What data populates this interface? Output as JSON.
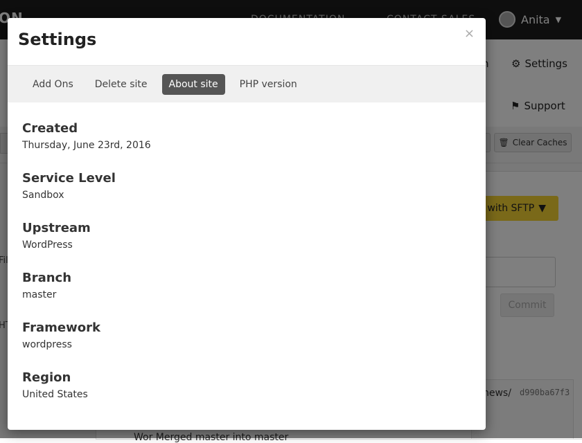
{
  "background": {
    "logo_text": "ON",
    "nav": [
      "DOCUMENTATION",
      "CONTACT SALES"
    ],
    "user_name": "Anita",
    "header_items": [
      {
        "label": "n"
      },
      {
        "label": "Settings",
        "icon": "gear-icon"
      }
    ],
    "subnav_items": [
      {
        "label": "Support",
        "icon": "flag-icon"
      }
    ],
    "clear_caches_label": "Clear Caches",
    "sftp_label": "t with SFTP",
    "commit_label": "Commit",
    "log_path": "news/",
    "log_hash": "d990ba67f3",
    "log_message": "Wor Merged master into master",
    "side_fragments": [
      "Fil",
      "HT"
    ]
  },
  "modal": {
    "title": "Settings",
    "close_symbol": "×",
    "tabs": [
      {
        "label": "Add Ons",
        "active": false
      },
      {
        "label": "Delete site",
        "active": false
      },
      {
        "label": "About site",
        "active": true
      },
      {
        "label": "PHP version",
        "active": false
      }
    ],
    "fields": [
      {
        "label": "Created",
        "value": "Thursday, June 23rd, 2016"
      },
      {
        "label": "Service Level",
        "value": "Sandbox"
      },
      {
        "label": "Upstream",
        "value": "WordPress"
      },
      {
        "label": "Branch",
        "value": "master"
      },
      {
        "label": "Framework",
        "value": "wordpress"
      },
      {
        "label": "Region",
        "value": "United States"
      }
    ]
  },
  "colors": {
    "active_tab": "#555555",
    "sftp_button": "#f4d233",
    "topbar": "#1d1d1d"
  }
}
